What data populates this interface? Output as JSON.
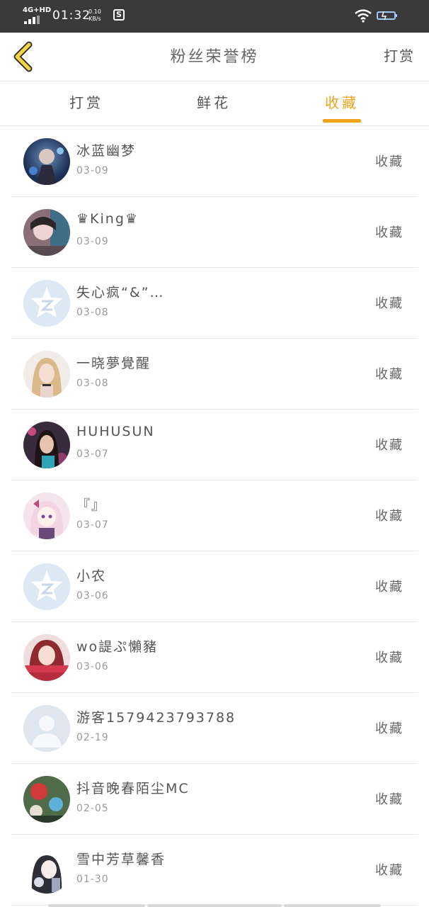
{
  "status_bar": {
    "network": "4G+HD",
    "time": "01:32",
    "speed_value": "0.10",
    "speed_unit": "KB/s"
  },
  "header": {
    "title": "粉丝荣誉榜",
    "right_action": "打赏"
  },
  "tabs": [
    {
      "label": "打赏"
    },
    {
      "label": "鲜花"
    },
    {
      "label": "收藏"
    }
  ],
  "active_tab": "收藏",
  "accent_color": "#f0a21c",
  "fans": [
    {
      "name": "冰蓝幽梦",
      "date": "03-09",
      "action": "收藏",
      "avatar": "photo-avatar"
    },
    {
      "name": "♛King♛",
      "date": "03-09",
      "action": "收藏",
      "avatar": "photo-avatar"
    },
    {
      "name": "失心疯“&”…",
      "date": "03-08",
      "action": "收藏",
      "avatar": "default-qq-avatar"
    },
    {
      "name": "一晓夢覺醒",
      "date": "03-08",
      "action": "收藏",
      "avatar": "photo-avatar"
    },
    {
      "name": "HUHUSUN",
      "date": "03-07",
      "action": "收藏",
      "avatar": "photo-avatar"
    },
    {
      "name": "『』",
      "date": "03-07",
      "action": "收藏",
      "avatar": "anime-avatar"
    },
    {
      "name": "小农",
      "date": "03-06",
      "action": "收藏",
      "avatar": "default-qq-avatar"
    },
    {
      "name": "wo諟ぷ懶豬",
      "date": "03-06",
      "action": "收藏",
      "avatar": "photo-avatar"
    },
    {
      "name": "游客1579423793788",
      "date": "02-19",
      "action": "收藏",
      "avatar": "default-person-avatar"
    },
    {
      "name": "抖音晚春陌尘MC",
      "date": "02-05",
      "action": "收藏",
      "avatar": "photo-avatar"
    },
    {
      "name": "雪中芳草馨香",
      "date": "01-30",
      "action": "收藏",
      "avatar": "photo-avatar"
    }
  ]
}
